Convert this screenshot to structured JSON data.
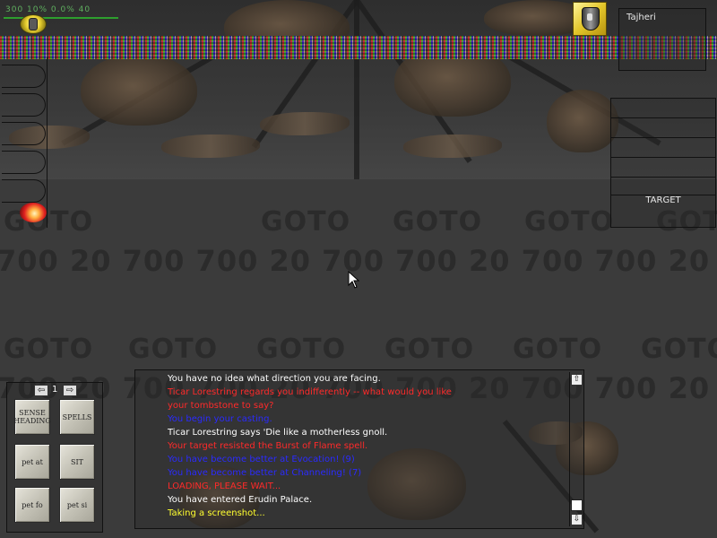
{
  "hud": {
    "stats": "300  10%  0.0%   40"
  },
  "player": {
    "name": "Tajheri"
  },
  "group": {
    "target_label": "TARGET"
  },
  "world": {
    "goto_text": "GOTO",
    "number_text": "700 20 700 700 20 700 700 20 700 700 20 700 700 20 700 700 20 700 700"
  },
  "hotbar": {
    "page": "1",
    "prev_arrow": "⇦",
    "next_arrow": "⇨",
    "buttons": [
      {
        "label": "SENSE HEADING"
      },
      {
        "label": "SPELLS"
      },
      {
        "label": "pet at"
      },
      {
        "label": "SIT"
      },
      {
        "label": "pet fo"
      },
      {
        "label": "pet si"
      }
    ]
  },
  "chat": {
    "lines": [
      {
        "text": "You have no idea what direction you are facing.",
        "color": "#ffffff"
      },
      {
        "text": "Ticar Lorestring regards you indifferently -- what would you like",
        "color": "#ff2a2a"
      },
      {
        "text": "your tombstone to say?",
        "color": "#ff2a2a"
      },
      {
        "text": "You begin your casting.",
        "color": "#2a2aff"
      },
      {
        "text": "Ticar Lorestring says 'Die like a motherless gnoll.",
        "color": "#ffffff"
      },
      {
        "text": "Your target resisted the Burst of Flame spell.",
        "color": "#ff2a2a"
      },
      {
        "text": "You have become better at Evocation! (9)",
        "color": "#2a2aff"
      },
      {
        "text": "You have become better at Channeling! (7)",
        "color": "#2a2aff"
      },
      {
        "text": "LOADING, PLEASE WAIT...",
        "color": "#ff2a2a"
      },
      {
        "text": "You have entered Erudin Palace.",
        "color": "#ffffff"
      },
      {
        "text": "Taking a screenshot...",
        "color": "#ffff30"
      }
    ],
    "scroll_up": "⇧",
    "scroll_down": "⇩"
  },
  "colors": {
    "hud_green": "#2e9e2e",
    "chat_white": "#ffffff",
    "chat_red": "#ff2a2a",
    "chat_blue": "#2a2aff",
    "chat_yellow": "#ffff30",
    "shield_gold": "#e2c52a"
  },
  "icons": {
    "compass": "compass-icon",
    "shield": "shield-icon",
    "fire": "fire-icon",
    "cursor": "mouse-cursor-icon"
  }
}
